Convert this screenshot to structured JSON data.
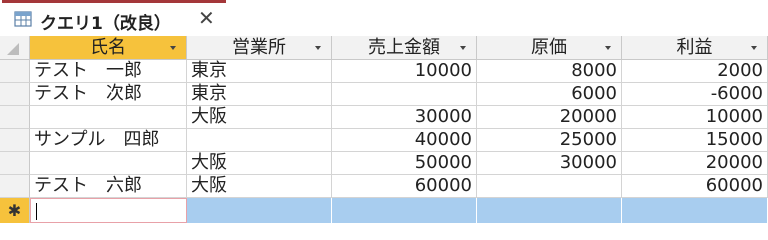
{
  "tab": {
    "icon": "table-query-icon",
    "title": "クエリ1（改良）",
    "close_glyph": "✕"
  },
  "columns": [
    {
      "label": "氏名",
      "align": "left"
    },
    {
      "label": "営業所",
      "align": "left"
    },
    {
      "label": "売上金額",
      "align": "right"
    },
    {
      "label": "原価",
      "align": "right"
    },
    {
      "label": "利益",
      "align": "right"
    }
  ],
  "rows": [
    [
      "テスト　一郎",
      "東京",
      "10000",
      "8000",
      "2000"
    ],
    [
      "テスト　次郎",
      "東京",
      "",
      "6000",
      "-6000"
    ],
    [
      "",
      "大阪",
      "30000",
      "20000",
      "10000"
    ],
    [
      "サンプル　四郎",
      "",
      "40000",
      "25000",
      "15000"
    ],
    [
      "",
      "大阪",
      "50000",
      "30000",
      "20000"
    ],
    [
      "テスト　六郎",
      "大阪",
      "60000",
      "",
      "60000"
    ]
  ],
  "new_row_marker": "✱",
  "colors": {
    "tab_accent": "#a4373a",
    "selected_header": "#f6c23c",
    "new_row_fill": "#a8cdef"
  }
}
